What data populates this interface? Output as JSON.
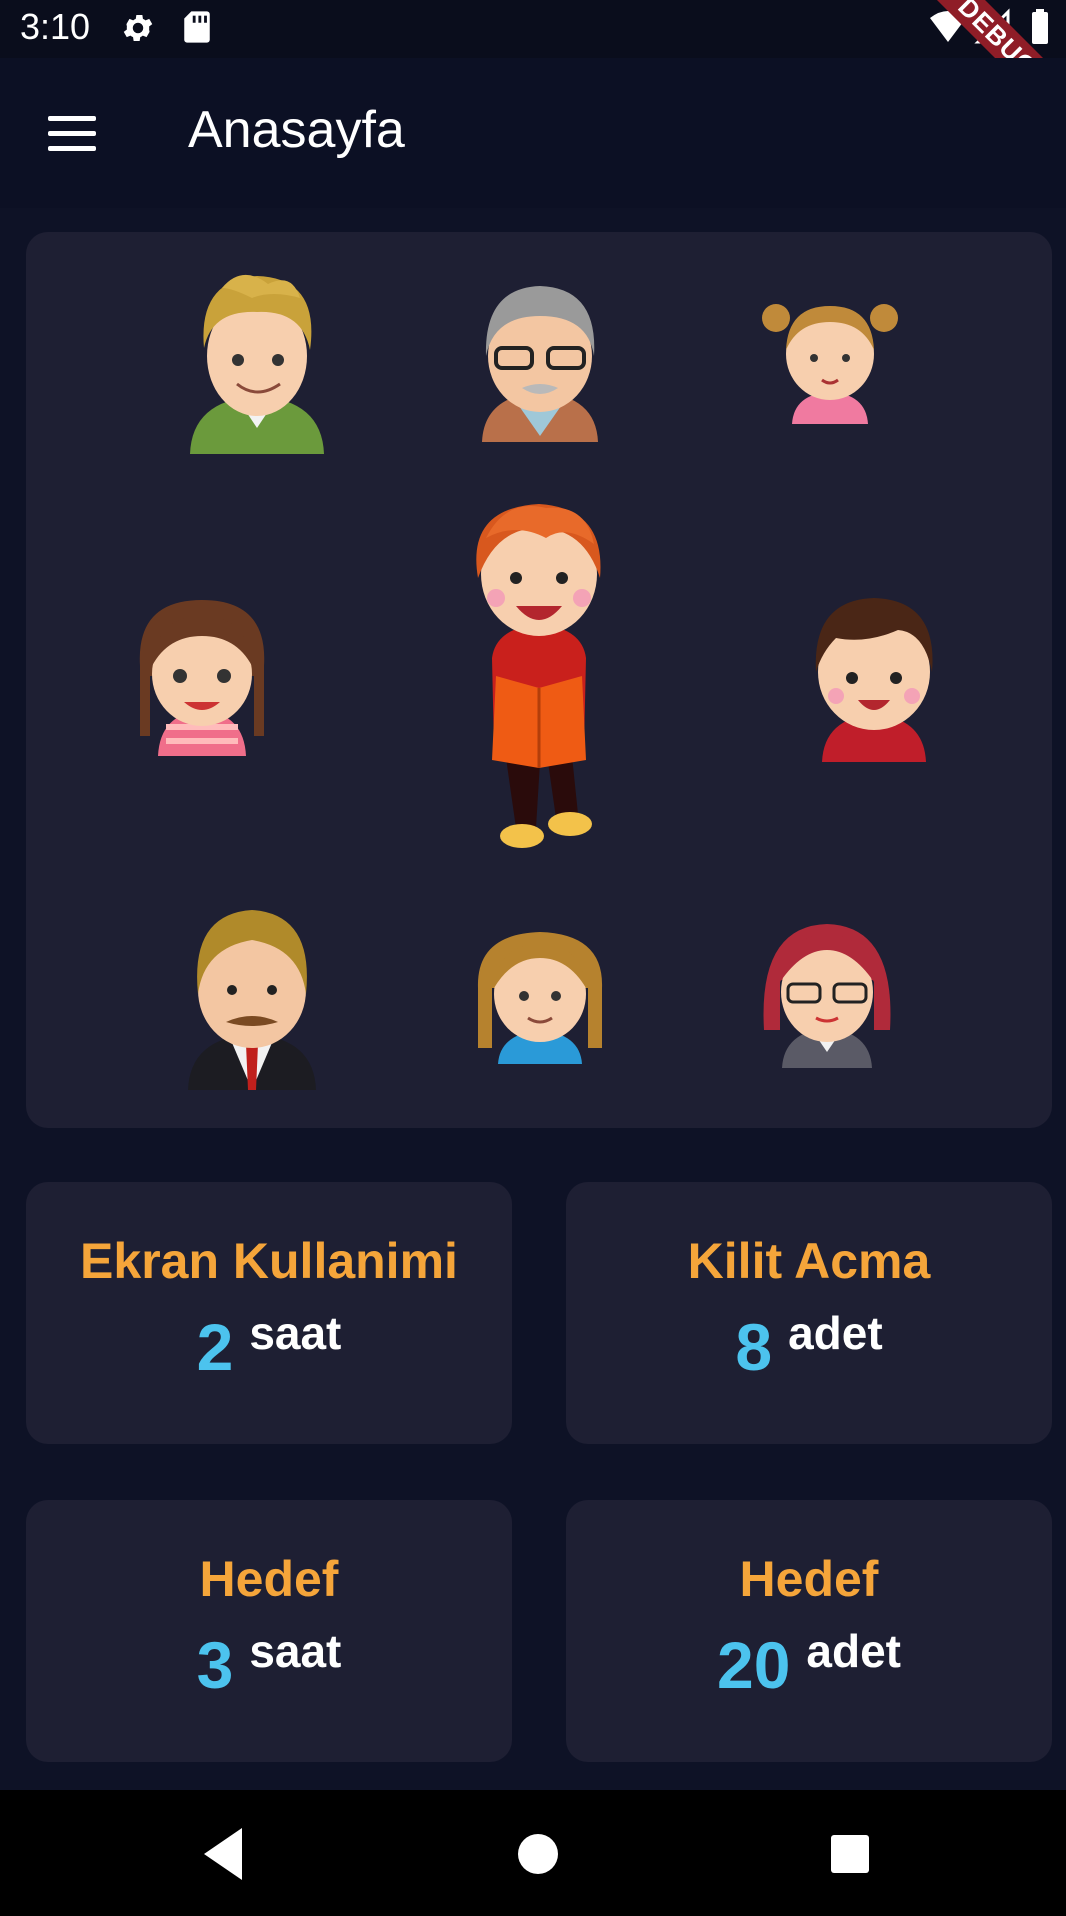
{
  "status_bar": {
    "time": "3:10",
    "icons": [
      "settings-gear-icon",
      "sd-card-icon",
      "wifi-icon",
      "signal-icon",
      "battery-icon"
    ],
    "debug_badge": "DEBUG"
  },
  "app_bar": {
    "menu_icon": "hamburger-menu-icon",
    "title": "Anasayfa"
  },
  "characters": [
    "man-green-shirt",
    "grandfather-glasses",
    "girl-pigtails",
    "girl-braids",
    "boy-reading-book",
    "boy-red-shirt",
    "man-suit-mustache",
    "girl-blue-shirt",
    "woman-glasses"
  ],
  "stats": [
    {
      "title": "Ekran Kullanimi",
      "value": "2",
      "unit": "saat"
    },
    {
      "title": "Kilit Acma",
      "value": "8",
      "unit": "adet"
    },
    {
      "title": "Hedef",
      "value": "3",
      "unit": "saat"
    },
    {
      "title": "Hedef",
      "value": "20",
      "unit": "adet"
    }
  ],
  "nav_bar": {
    "icons": [
      "back-triangle-icon",
      "home-circle-icon",
      "recents-square-icon"
    ]
  },
  "colors": {
    "background": "#0e1226",
    "card": "#1e1f33",
    "title_orange": "#f5a53a",
    "value_blue": "#4cc3ee"
  }
}
